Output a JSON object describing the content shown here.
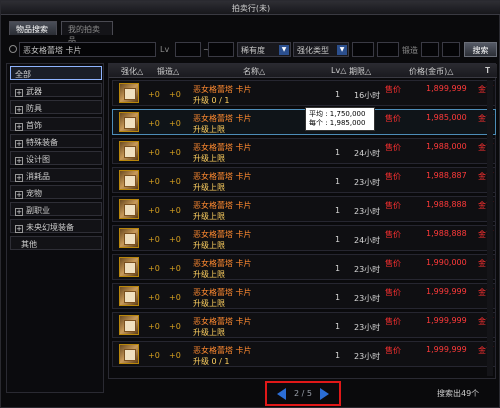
{
  "window": {
    "title": "拍卖行(未)"
  },
  "tabs": [
    {
      "label": "物品搜索"
    },
    {
      "label": "我的拍卖品"
    }
  ],
  "search": {
    "query": "恶女格蕾塔 卡片",
    "lv_label": "Lv",
    "tilde": "~",
    "rarity": "稀有度",
    "enhance_type": "强化类型",
    "forge_label": "锻造",
    "button": "搜索"
  },
  "sidebar": {
    "items": [
      {
        "label": "全部",
        "expandable": false
      },
      {
        "label": "武器",
        "expandable": true
      },
      {
        "label": "防具",
        "expandable": true
      },
      {
        "label": "首饰",
        "expandable": true
      },
      {
        "label": "特殊装备",
        "expandable": true
      },
      {
        "label": "设计图",
        "expandable": true
      },
      {
        "label": "消耗品",
        "expandable": true
      },
      {
        "label": "宠物",
        "expandable": true
      },
      {
        "label": "副职业",
        "expandable": true
      },
      {
        "label": "未央幻境装备",
        "expandable": true
      },
      {
        "label": "其他",
        "expandable": false
      }
    ]
  },
  "table": {
    "headers": {
      "enhance": "强化△",
      "forge": "锻造△",
      "name": "名称△",
      "lv": "Lv△",
      "time": "期限△",
      "price": "价格(金币)△"
    },
    "rows": [
      {
        "plus1": "+0",
        "plus2": "+0",
        "name": "恶女格蕾塔  卡片",
        "sub": "升级 0 / 1",
        "qty": "1",
        "time": "16小时",
        "sell": "售价",
        "price": "1,899,999",
        "cur": "金币"
      },
      {
        "plus1": "+0",
        "plus2": "+0",
        "name": "恶女格蕾塔  卡片",
        "sub": "升级上限",
        "qty": "1",
        "time": "",
        "sell": "售价",
        "price": "1,985,000",
        "cur": "金币"
      },
      {
        "plus1": "+0",
        "plus2": "+0",
        "name": "恶女格蕾塔  卡片",
        "sub": "升级上限",
        "qty": "1",
        "time": "24小时",
        "sell": "售价",
        "price": "1,988,000",
        "cur": "金币"
      },
      {
        "plus1": "+0",
        "plus2": "+0",
        "name": "恶女格蕾塔  卡片",
        "sub": "升级上限",
        "qty": "1",
        "time": "23小时",
        "sell": "售价",
        "price": "1,988,887",
        "cur": "金币"
      },
      {
        "plus1": "+0",
        "plus2": "+0",
        "name": "恶女格蕾塔  卡片",
        "sub": "升级上限",
        "qty": "1",
        "time": "23小时",
        "sell": "售价",
        "price": "1,988,888",
        "cur": "金币"
      },
      {
        "plus1": "+0",
        "plus2": "+0",
        "name": "恶女格蕾塔  卡片",
        "sub": "升级上限",
        "qty": "1",
        "time": "24小时",
        "sell": "售价",
        "price": "1,988,888",
        "cur": "金币"
      },
      {
        "plus1": "+0",
        "plus2": "+0",
        "name": "恶女格蕾塔  卡片",
        "sub": "升级上限",
        "qty": "1",
        "time": "23小时",
        "sell": "售价",
        "price": "1,990,000",
        "cur": "金币"
      },
      {
        "plus1": "+0",
        "plus2": "+0",
        "name": "恶女格蕾塔  卡片",
        "sub": "升级上限",
        "qty": "1",
        "time": "23小时",
        "sell": "售价",
        "price": "1,999,999",
        "cur": "金币"
      },
      {
        "plus1": "+0",
        "plus2": "+0",
        "name": "恶女格蕾塔  卡片",
        "sub": "升级上限",
        "qty": "1",
        "time": "23小时",
        "sell": "售价",
        "price": "1,999,999",
        "cur": "金币"
      },
      {
        "plus1": "+0",
        "plus2": "+0",
        "name": "恶女格蕾塔  卡片",
        "sub": "升级 0 / 1",
        "qty": "1",
        "time": "23小时",
        "sell": "售价",
        "price": "1,999,999",
        "cur": "金币"
      }
    ]
  },
  "tooltip": {
    "avg": "平均 : 1,750,000",
    "each": "每个 : 1,985,000"
  },
  "pager": {
    "text": "2 / 5"
  },
  "result_count": "搜索出49个"
}
